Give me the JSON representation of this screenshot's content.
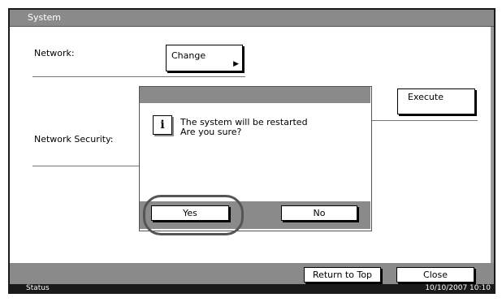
{
  "header": {
    "title": "System"
  },
  "settings": {
    "network_label": "Network:",
    "change_button": "Change",
    "execute_button": "Execute",
    "network_security_label": "Network Security:"
  },
  "dialog": {
    "icon": "info-icon",
    "message_line1": "The system will be restarted",
    "message_line2": "Are you sure?",
    "yes_button": "Yes",
    "no_button": "No"
  },
  "footer": {
    "return_to_top_button": "Return to Top",
    "close_button": "Close"
  },
  "statusbar": {
    "status_label": "Status",
    "datetime": "10/10/2007   10:10"
  }
}
